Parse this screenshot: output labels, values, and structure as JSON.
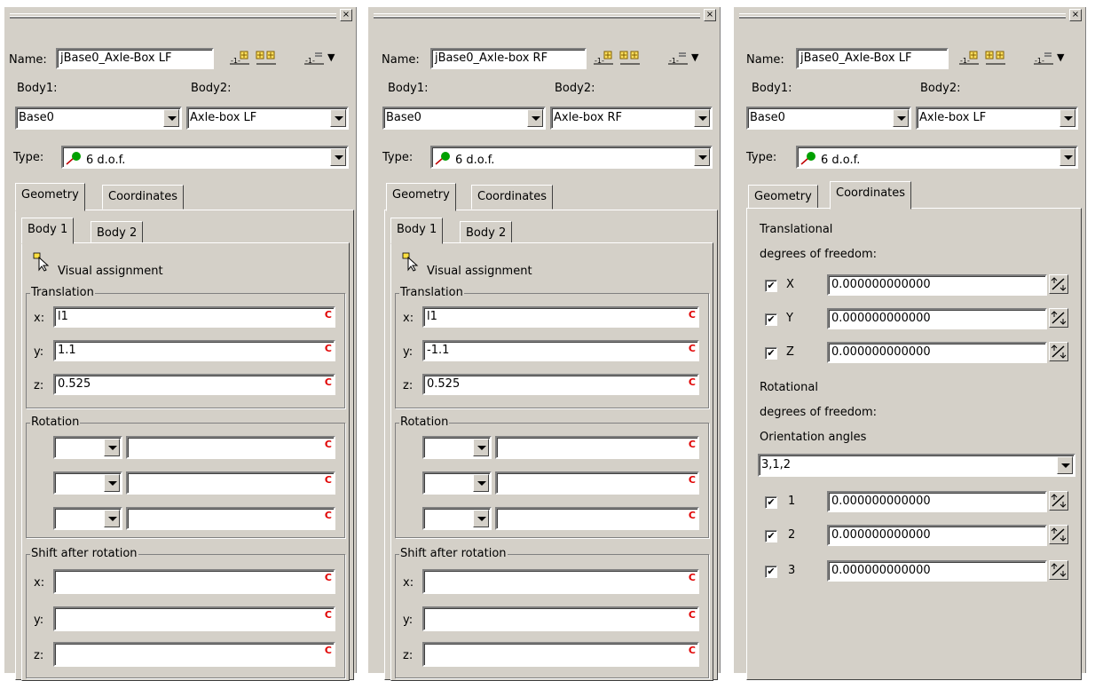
{
  "panels": [
    {
      "name_label": "Name:",
      "name_value": "jBase0_Axle-Box LF",
      "body1_label": "Body1:",
      "body2_label": "Body2:",
      "body1_value": "Base0",
      "body2_value": "Axle-box LF",
      "type_label": "Type:",
      "type_value": "6 d.o.f.",
      "tabs": [
        "Geometry",
        "Coordinates"
      ],
      "active_tab": "Geometry",
      "subtabs": [
        "Body 1",
        "Body 2"
      ],
      "visual_assignment": "Visual assignment",
      "translation_title": "Translation",
      "x_label": "x:",
      "y_label": "y:",
      "z_label": "z:",
      "tx": "l1",
      "ty": "1.1",
      "tz": "0.525",
      "rotation_title": "Rotation",
      "shift_title": "Shift after rotation",
      "c_marker": "C"
    },
    {
      "name_label": "Name:",
      "name_value": "jBase0_Axle-box RF",
      "body1_label": "Body1:",
      "body2_label": "Body2:",
      "body1_value": "Base0",
      "body2_value": "Axle-box RF",
      "type_label": "Type:",
      "type_value": "6 d.o.f.",
      "tabs": [
        "Geometry",
        "Coordinates"
      ],
      "active_tab": "Geometry",
      "subtabs": [
        "Body 1",
        "Body 2"
      ],
      "visual_assignment": "Visual assignment",
      "translation_title": "Translation",
      "x_label": "x:",
      "y_label": "y:",
      "z_label": "z:",
      "tx": "l1",
      "ty": "-1.1",
      "tz": "0.525",
      "rotation_title": "Rotation",
      "shift_title": "Shift after rotation",
      "c_marker": "C"
    },
    {
      "name_label": "Name:",
      "name_value": "jBase0_Axle-Box LF",
      "body1_label": "Body1:",
      "body2_label": "Body2:",
      "body1_value": "Base0",
      "body2_value": "Axle-box LF",
      "type_label": "Type:",
      "type_value": "6 d.o.f.",
      "tabs": [
        "Geometry",
        "Coordinates"
      ],
      "active_tab": "Coordinates",
      "translational_line1": "Translational",
      "translational_line2": "degrees of freedom:",
      "trans_dofs": [
        {
          "label": "X",
          "value": "0.000000000000",
          "checked": true
        },
        {
          "label": "Y",
          "value": "0.000000000000",
          "checked": true
        },
        {
          "label": "Z",
          "value": "0.000000000000",
          "checked": true
        }
      ],
      "rotational_line1": "Rotational",
      "rotational_line2": "degrees of freedom:",
      "orientation_label": "Orientation angles",
      "orientation_value": "3,1,2",
      "rot_dofs": [
        {
          "label": "1",
          "value": "0.000000000000",
          "checked": true
        },
        {
          "label": "2",
          "value": "0.000000000000",
          "checked": true
        },
        {
          "label": "3",
          "value": "0.000000000000",
          "checked": true
        }
      ]
    }
  ],
  "close_glyph": "×",
  "check_glyph": "✔",
  "colors": {
    "face": "#d4d0c8",
    "c_marker": "#e00000",
    "icon_green": "#00a000"
  }
}
